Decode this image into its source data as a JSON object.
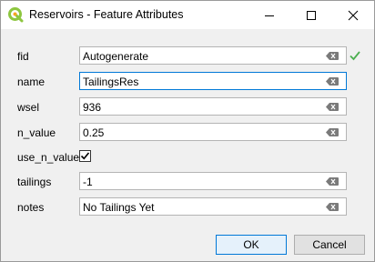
{
  "window": {
    "title": "Reservoirs - Feature Attributes"
  },
  "fields": [
    {
      "name": "fid",
      "label": "fid",
      "value": "Autogenerate"
    },
    {
      "name": "name",
      "label": "name",
      "value": "TailingsRes"
    },
    {
      "name": "wsel",
      "label": "wsel",
      "value": "936"
    },
    {
      "name": "n_value",
      "label": "n_value",
      "value": "0.25"
    },
    {
      "name": "use_n_value",
      "label": "use_n_value",
      "checked": true
    },
    {
      "name": "tailings",
      "label": "tailings",
      "value": "-1"
    },
    {
      "name": "notes",
      "label": "notes",
      "value": "No Tailings Yet"
    }
  ],
  "buttons": {
    "ok": "OK",
    "cancel": "Cancel"
  },
  "colors": {
    "accent": "#0078d7",
    "valid_check": "#4caf50",
    "qgis_green": "#8dc63f"
  },
  "icons": [
    "qgis-logo-icon",
    "minimize-icon",
    "maximize-icon",
    "close-icon",
    "clear-field-icon",
    "valid-checkmark-icon",
    "checkbox-checked-icon"
  ]
}
